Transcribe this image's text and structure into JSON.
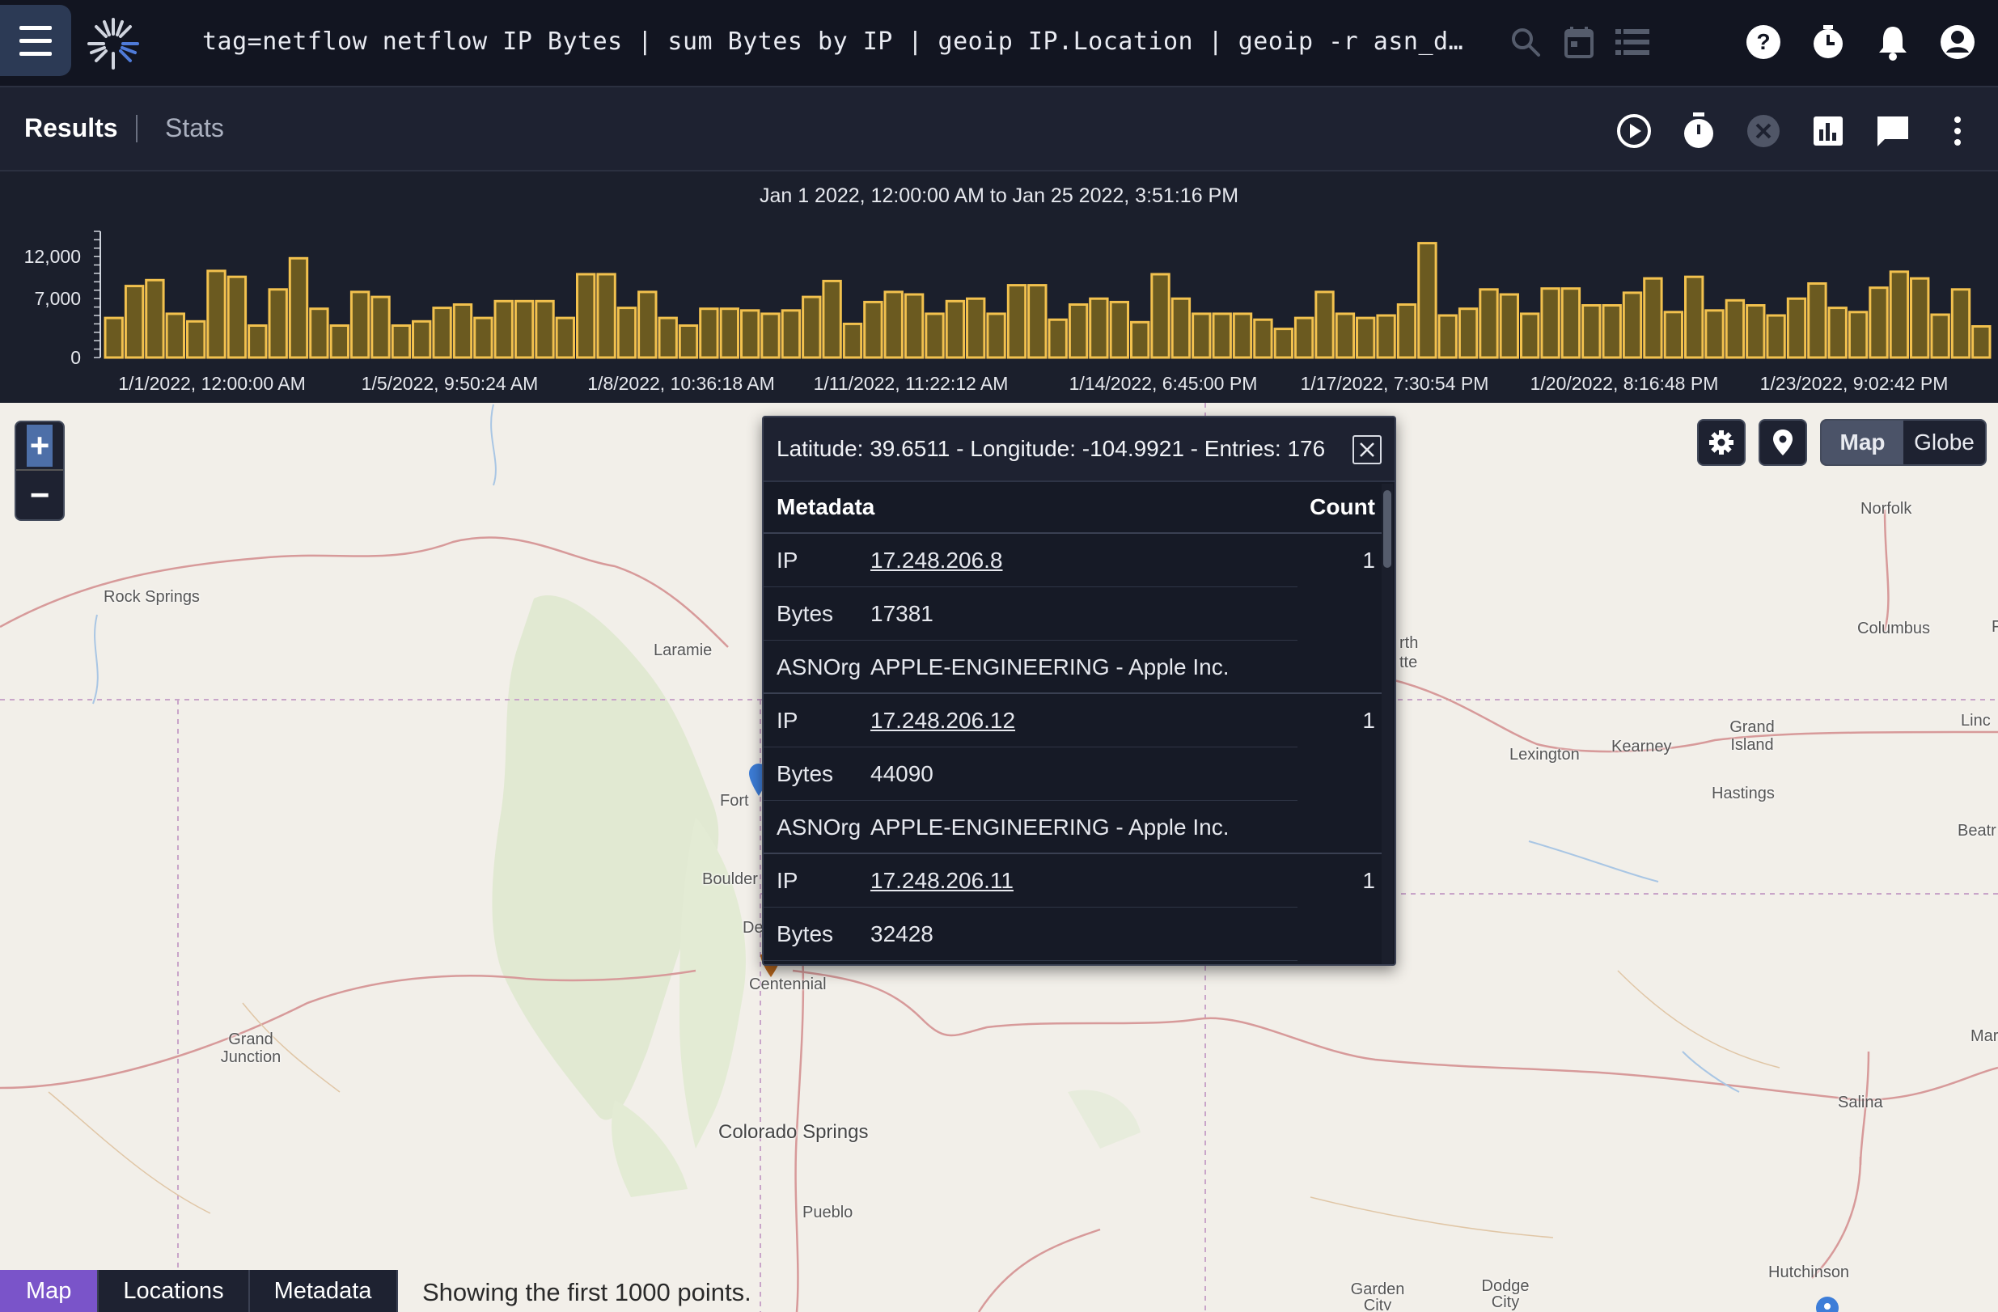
{
  "topbar": {
    "query": "tag=netflow netflow IP Bytes | sum Bytes by IP | geoip IP.Location | geoip -r asn_db IP.ASN…",
    "icons": [
      "menu-icon",
      "logo-icon",
      "search-icon",
      "calendar-icon",
      "list-icon",
      "help-icon",
      "history-icon",
      "bell-icon",
      "account-icon"
    ]
  },
  "results_bar": {
    "tab_results": "Results",
    "tab_stats": "Stats",
    "icons": [
      "play-icon",
      "timer-icon",
      "cancel-icon",
      "chart-icon",
      "comment-icon",
      "more-icon"
    ]
  },
  "chart": {
    "range_label": "Jan 1 2022, 12:00:00 AM to Jan 25 2022, 3:51:16 PM"
  },
  "chart_data": {
    "type": "bar",
    "title": "Jan 1 2022, 12:00:00 AM to Jan 25 2022, 3:51:16 PM",
    "xlabel": "",
    "ylabel": "",
    "ylim": [
      0,
      15000
    ],
    "yticks": [
      "12,000",
      "7,000",
      "0"
    ],
    "ytick_values": [
      12000,
      7000,
      0
    ],
    "xticks": [
      "1/1/2022, 12:00:00 AM",
      "1/5/2022, 9:50:24 AM",
      "1/8/2022, 10:36:18 AM",
      "1/11/2022, 11:22:12 AM",
      "1/14/2022, 6:45:00 PM",
      "1/17/2022, 7:30:54 PM",
      "1/20/2022, 8:16:48 PM",
      "1/23/2022, 9:02:42 PM"
    ],
    "color": "#f2c14e",
    "fill": "#6b5a20",
    "values": [
      4700,
      8500,
      9200,
      5200,
      4300,
      10300,
      9600,
      3800,
      8100,
      11800,
      5800,
      3800,
      7800,
      7200,
      3800,
      4300,
      5900,
      6300,
      4700,
      6700,
      6700,
      6700,
      4700,
      9900,
      9900,
      5900,
      7800,
      4700,
      3800,
      5800,
      5800,
      5600,
      5200,
      5600,
      7200,
      9100,
      4000,
      6600,
      7800,
      7500,
      5200,
      6700,
      7000,
      5200,
      8600,
      8600,
      4500,
      6300,
      7000,
      6600,
      4200,
      9900,
      7000,
      5200,
      5200,
      5200,
      4500,
      3400,
      4700,
      7800,
      5200,
      4700,
      5000,
      6300,
      13600,
      5000,
      5800,
      8100,
      7500,
      5200,
      8200,
      8200,
      6200,
      6200,
      7700,
      9400,
      5400,
      9600,
      5600,
      6800,
      6200,
      5000,
      7000,
      8800,
      5900,
      5400,
      8300,
      10200,
      9400,
      5100,
      8100,
      3700
    ]
  },
  "map": {
    "zoom_in": "+",
    "zoom_out": "−",
    "toggle": [
      "Map",
      "Globe"
    ],
    "active_toggle": "Map",
    "cities": [
      "Rock Springs",
      "Laramie",
      "Fort",
      "Boulder",
      "De",
      "Centennial",
      "Grand Junction",
      "Colorado Springs",
      "Pueblo",
      "Norfolk",
      "Columbus",
      "Grand Island",
      "Kearney",
      "Lexington",
      "Hastings",
      "Linc",
      "Beatr",
      "Salina",
      "Hutchinson",
      "Garden City",
      "Dodge City",
      "Mar",
      "rth",
      "tte",
      "F"
    ]
  },
  "popup": {
    "header": "Latitude: 39.6511 - Longitude: -104.9921 - Entries: 176",
    "col_metadata": "Metadata",
    "col_count": "Count",
    "rows": [
      {
        "key": "IP",
        "value": "17.248.206.8",
        "count": "1"
      },
      {
        "key": "Bytes",
        "value": "17381",
        "count": ""
      },
      {
        "key": "ASNOrg",
        "value": "APPLE-ENGINEERING - Apple Inc.",
        "count": ""
      },
      {
        "key": "IP",
        "value": "17.248.206.12",
        "count": "1"
      },
      {
        "key": "Bytes",
        "value": "44090",
        "count": ""
      },
      {
        "key": "ASNOrg",
        "value": "APPLE-ENGINEERING - Apple Inc.",
        "count": ""
      },
      {
        "key": "IP",
        "value": "17.248.206.11",
        "count": "1"
      },
      {
        "key": "Bytes",
        "value": "32428",
        "count": ""
      }
    ]
  },
  "bottom": {
    "tabs": [
      "Map",
      "Locations",
      "Metadata"
    ],
    "active_tab": "Map",
    "status": "Showing the first 1000 points."
  }
}
